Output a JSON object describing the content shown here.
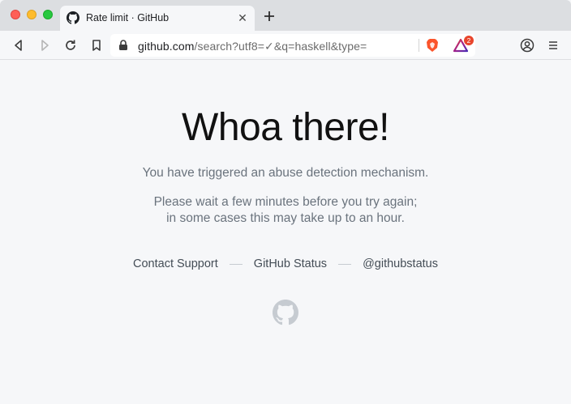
{
  "browser": {
    "tab": {
      "title": "Rate limit · GitHub",
      "close_icon": "close-icon",
      "favicon": "github-octocat-icon"
    },
    "new_tab_icon": "plus-icon",
    "toolbar": {
      "back_icon": "back-arrow-icon",
      "forward_icon": "forward-arrow-icon",
      "reload_icon": "reload-icon",
      "bookmark_icon": "bookmark-icon",
      "profile_icon": "profile-icon",
      "menu_icon": "hamburger-menu-icon"
    },
    "address_bar": {
      "host": "github.com",
      "path": "/search?utf8=✓&q=haskell&type=",
      "lock_icon": "lock-icon"
    },
    "extensions": {
      "brave_shields_icon": "brave-lion-icon",
      "rewards_icon": "brave-rewards-triangle-icon",
      "rewards_badge": "2"
    }
  },
  "page": {
    "headline": "Whoa there!",
    "message_line1": "You have triggered an abuse detection mechanism.",
    "message_line2a": "Please wait a few minutes before you try again;",
    "message_line2b": "in some cases this may take up to an hour.",
    "links": [
      {
        "label": "Contact Support"
      },
      {
        "label": "GitHub Status"
      },
      {
        "label": "@githubstatus"
      }
    ],
    "footer_icon": "github-octocat-icon"
  },
  "colors": {
    "background": "#f6f7f9",
    "tabstrip": "#dcdee1",
    "text_muted": "#6a737d",
    "link": "#444d56",
    "headline": "#111111"
  }
}
